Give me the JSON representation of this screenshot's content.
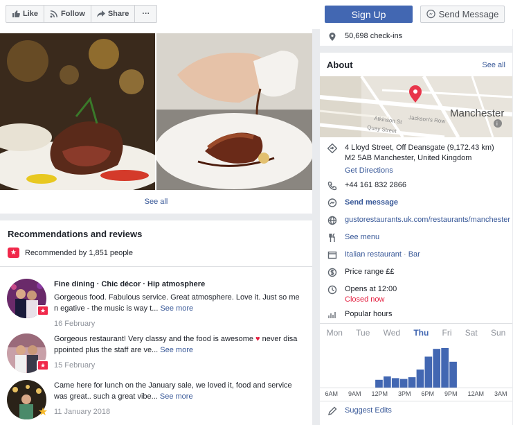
{
  "toolbar": {
    "like": "Like",
    "follow": "Follow",
    "share": "Share",
    "more": "···",
    "signup": "Sign Up",
    "send_message": "Send Message"
  },
  "photos": {
    "see_all": "See all"
  },
  "reviews": {
    "title": "Recommendations and reviews",
    "recommended": "Recommended by 1,851 people",
    "items": [
      {
        "heading": "Fine dining · Chic décor · Hip atmosphere",
        "text": "Gorgeous food. Fabulous service. Great atmosphere. Love it. Just so me n egative - the music is way t...",
        "more": "See more",
        "date": "16 February",
        "badge": "recommend"
      },
      {
        "heading": "",
        "text": "Gorgeous restaurant! Very classy and the food is awesome ",
        "text2": " never disa ppointed plus the staff are ve...",
        "more": "See more",
        "date": "15 February",
        "badge": "recommend"
      },
      {
        "heading": "",
        "text": "Came here for lunch on the January sale, we loved it, food and service was great.. such a great vibe...",
        "more": "See more",
        "date": "11 January 2018",
        "badge": "star"
      }
    ]
  },
  "sidebar": {
    "checkins": "50,698 check-ins",
    "about_title": "About",
    "about_see_all": "See all",
    "map_city": "Manchester",
    "map_labels": [
      "Atkinson St",
      "Jackson's Row",
      "Quay Street"
    ],
    "address_line1": "4 Lloyd Street, Off Deansgate (9,172.43 km)",
    "address_line2": "M2 5AB Manchester, United Kingdom",
    "directions": "Get Directions",
    "phone": "+44 161 832 2866",
    "send_message": "Send message",
    "website": "gustorestaurants.uk.com/restaurants/manchester",
    "menu": "See menu",
    "category1": "Italian restaurant",
    "category_sep": " · ",
    "category2": "Bar",
    "price": "Price range ££",
    "opens": "Opens at 12:00",
    "closed": "Closed now",
    "popular": "Popular hours",
    "days": [
      "Mon",
      "Tue",
      "Wed",
      "Thu",
      "Fri",
      "Sat",
      "Sun"
    ],
    "active_day": "Thu",
    "hour_labels": [
      "6AM",
      "9AM",
      "12PM",
      "3PM",
      "6PM",
      "9PM",
      "12AM",
      "3AM"
    ],
    "suggest_edits": "Suggest Edits"
  },
  "chart_data": {
    "type": "bar",
    "title": "Popular hours",
    "x": [
      "6AM",
      "7AM",
      "8AM",
      "9AM",
      "10AM",
      "11AM",
      "12PM",
      "1PM",
      "2PM",
      "3PM",
      "4PM",
      "5PM",
      "6PM",
      "7PM",
      "8PM",
      "9PM",
      "10PM",
      "11PM",
      "12AM",
      "1AM",
      "2AM",
      "3AM"
    ],
    "values": [
      0,
      0,
      0,
      0,
      0,
      0,
      18,
      26,
      22,
      20,
      24,
      42,
      72,
      90,
      92,
      60,
      0,
      0,
      0,
      0,
      0,
      0
    ],
    "ylim": [
      0,
      100
    ]
  },
  "colors": {
    "accent": "#4267b2",
    "link": "#385898",
    "closed": "#e41e3f",
    "recommend": "#f0284a"
  }
}
